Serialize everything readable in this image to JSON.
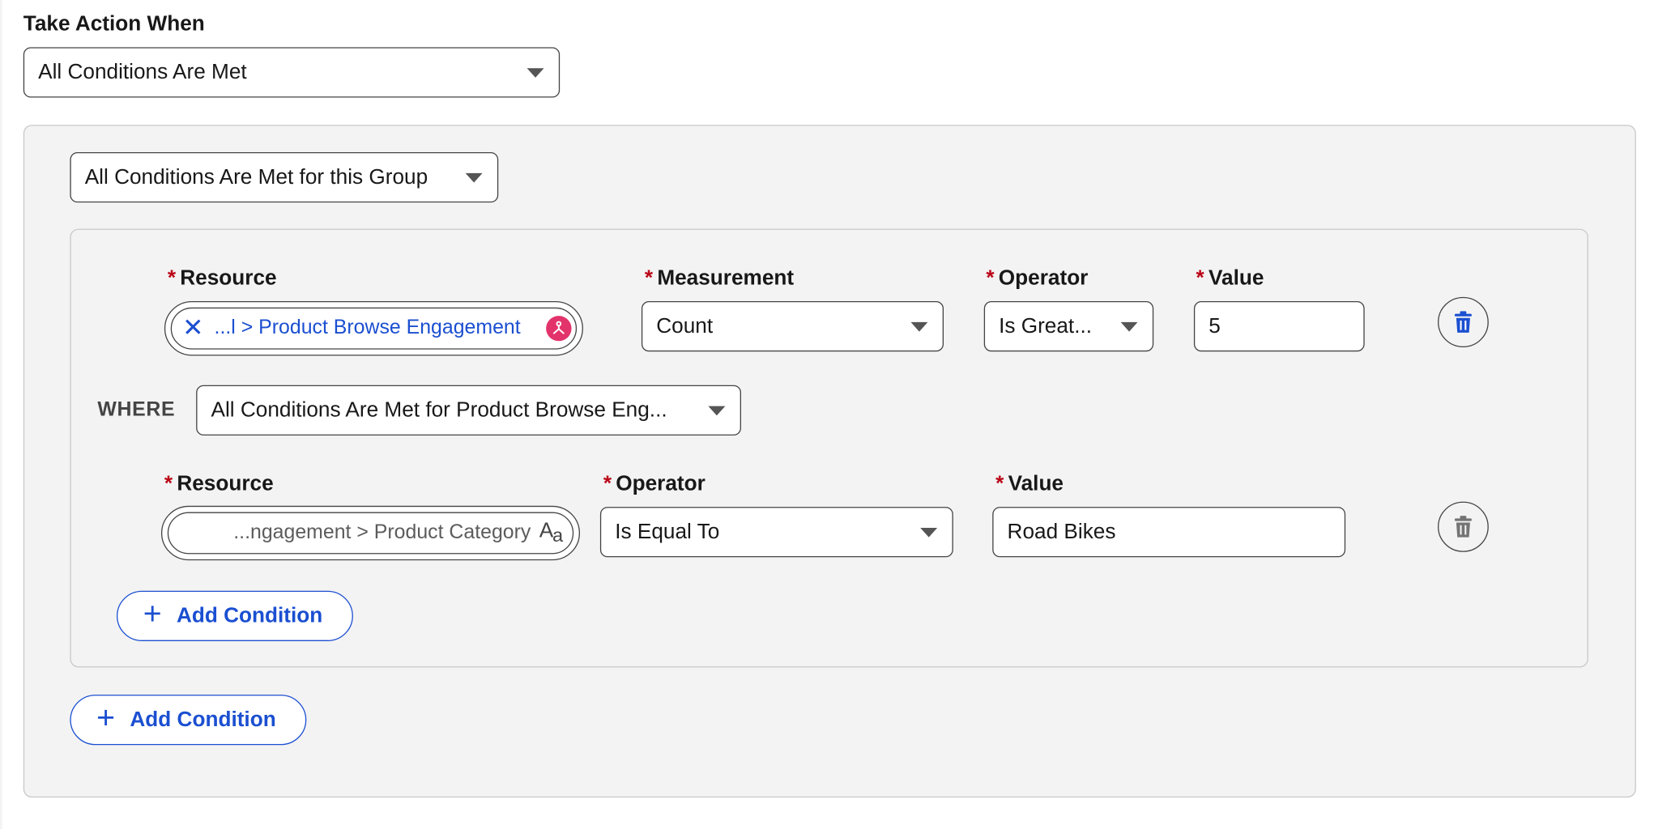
{
  "take_action": {
    "heading": "Take Action When",
    "selected": "All Conditions Are Met"
  },
  "group": {
    "selected": "All Conditions Are Met for this Group",
    "condition1": {
      "resource_label": "Resource",
      "resource_value": "...l > Product Browse Engagement",
      "resource_icon": "relationship-icon",
      "measurement_label": "Measurement",
      "measurement_value": "Count",
      "operator_label": "Operator",
      "operator_value": "Is Great...",
      "value_label": "Value",
      "value": "5",
      "delete_icon": "trash-icon"
    },
    "where": {
      "label": "WHERE",
      "selected": "All Conditions Are Met for Product Browse Eng..."
    },
    "condition2": {
      "resource_label": "Resource",
      "resource_value": "...ngagement > Product Category",
      "resource_icon": "text-type-icon",
      "operator_label": "Operator",
      "operator_value": "Is Equal To",
      "value_label": "Value",
      "value": "Road Bikes",
      "delete_icon": "trash-icon"
    },
    "inner_add_label": "Add Condition"
  },
  "outer_add_label": "Add Condition",
  "required_mark": "*",
  "colors": {
    "accent": "#1b4fd1",
    "required": "#ba0517",
    "panel": "#f3f3f3",
    "relationship_icon": "#e3336b"
  }
}
